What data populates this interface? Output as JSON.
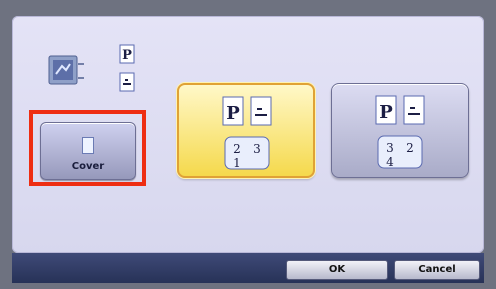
{
  "icons": {
    "scanner": "scanner-icon",
    "page_p": "page-p-icon",
    "page_image": "page-image-icon",
    "cover_doc": "document-icon",
    "staple": "staple-icon"
  },
  "cover_button": {
    "label": "Cover"
  },
  "cover_button_highlighted": true,
  "options": [
    {
      "name": "option-cover-front",
      "selected": true,
      "page_letter": "P",
      "lower_top": [
        "2",
        "3"
      ],
      "lower_bottom": "1"
    },
    {
      "name": "option-cover-back",
      "selected": false,
      "page_letter": "P",
      "lower_top": [
        "3",
        "2"
      ],
      "lower_bottom": "4"
    }
  ],
  "source_page_letter": "P",
  "footer": {
    "ok_label": "OK",
    "cancel_label": "Cancel"
  },
  "colors": {
    "highlight": "#ee2d12",
    "selected_option": "#f5d94c",
    "footer": "#273257"
  }
}
